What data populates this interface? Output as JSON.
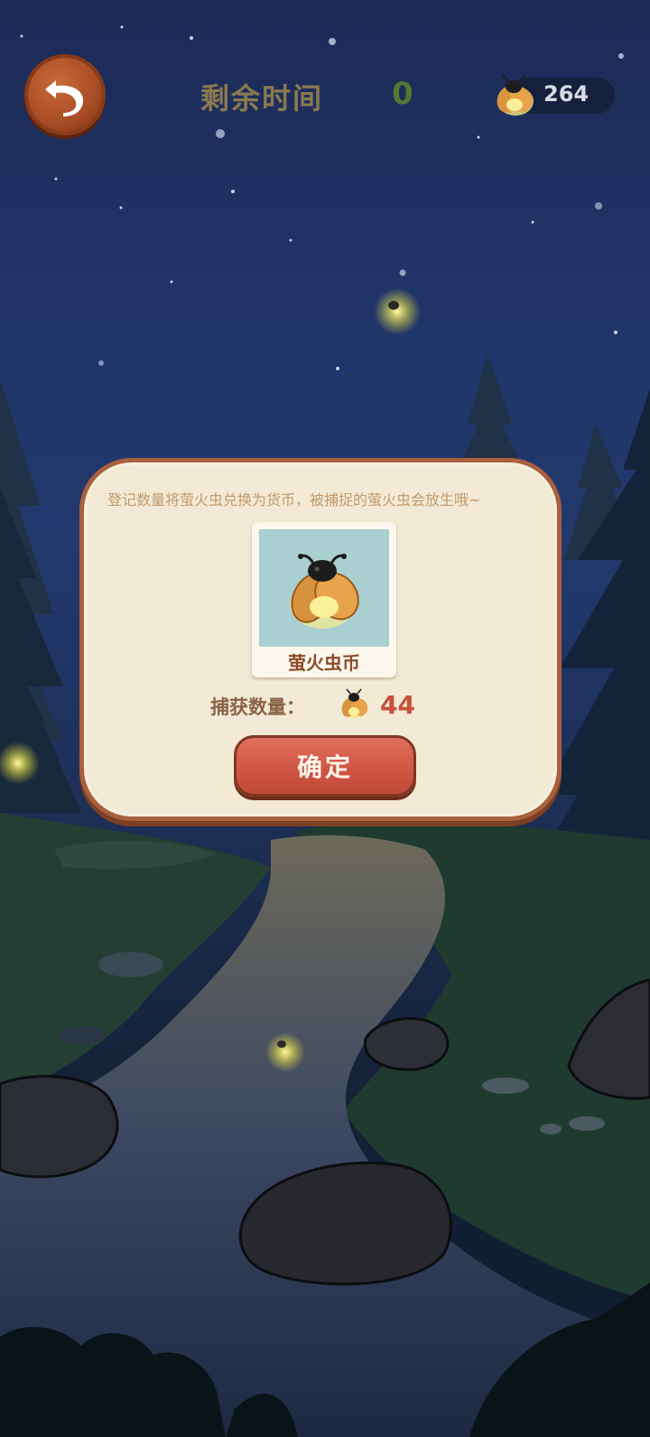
{
  "header": {
    "back_icon": "undo-arrow-icon",
    "timer_label": "剩余时间",
    "timer_value": "0",
    "coin_icon": "firefly-icon",
    "coin_count": "264"
  },
  "dialog": {
    "description": "登记数量将萤火虫兑换为货币，被捕捉的萤火虫会放生哦~",
    "card_icon": "firefly-icon",
    "card_label": "萤火虫币",
    "catch_label": "捕获数量：",
    "catch_icon": "firefly-icon",
    "catch_value": "44",
    "confirm_label": "确定"
  },
  "colors": {
    "sky": "#22396e",
    "dialog_bg": "#f2ead4",
    "dialog_border": "#a8603e",
    "confirm_button": "#cf5442",
    "timer_value": "#4f7a32",
    "catch_value": "#c7503e"
  }
}
